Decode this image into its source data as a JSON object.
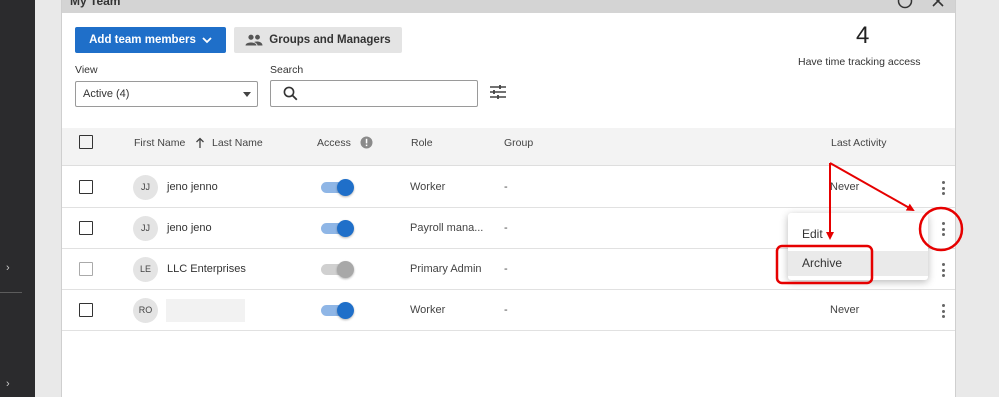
{
  "panel": {
    "title": "My Team"
  },
  "toolbar": {
    "add_members_label": "Add team members",
    "groups_label": "Groups and Managers"
  },
  "stats": {
    "count": "4",
    "label": "Have time tracking access"
  },
  "filters": {
    "view_label": "View",
    "view_value": "Active (4)",
    "search_label": "Search",
    "search_value": ""
  },
  "table": {
    "headers": {
      "first_name": "First Name",
      "last_name": "Last Name",
      "access": "Access",
      "role": "Role",
      "group": "Group",
      "last_activity": "Last Activity"
    },
    "rows": [
      {
        "initials": "JJ",
        "name": "jeno jenno",
        "access": true,
        "role": "Worker",
        "group": "-",
        "last_activity": "Never"
      },
      {
        "initials": "JJ",
        "name": "jeno jeno",
        "access": true,
        "role": "Payroll mana...",
        "group": "-",
        "last_activity": ""
      },
      {
        "initials": "LE",
        "name": "LLC Enterprises",
        "access": false,
        "role": "Primary Admin",
        "group": "-",
        "last_activity": ""
      },
      {
        "initials": "RO",
        "name": "",
        "access": true,
        "role": "Worker",
        "group": "-",
        "last_activity": "Never"
      }
    ]
  },
  "context_menu": {
    "edit_label": "Edit",
    "archive_label": "Archive"
  },
  "colors": {
    "primary": "#1f6fc9",
    "annotation": "#e60000"
  },
  "icons": [
    "chevron-right-icon",
    "help-icon",
    "close-icon",
    "chevron-down-icon",
    "people-icon",
    "search-icon",
    "filter-sliders-icon",
    "sort-arrow-up-icon",
    "info-icon",
    "more-vert-icon"
  ]
}
